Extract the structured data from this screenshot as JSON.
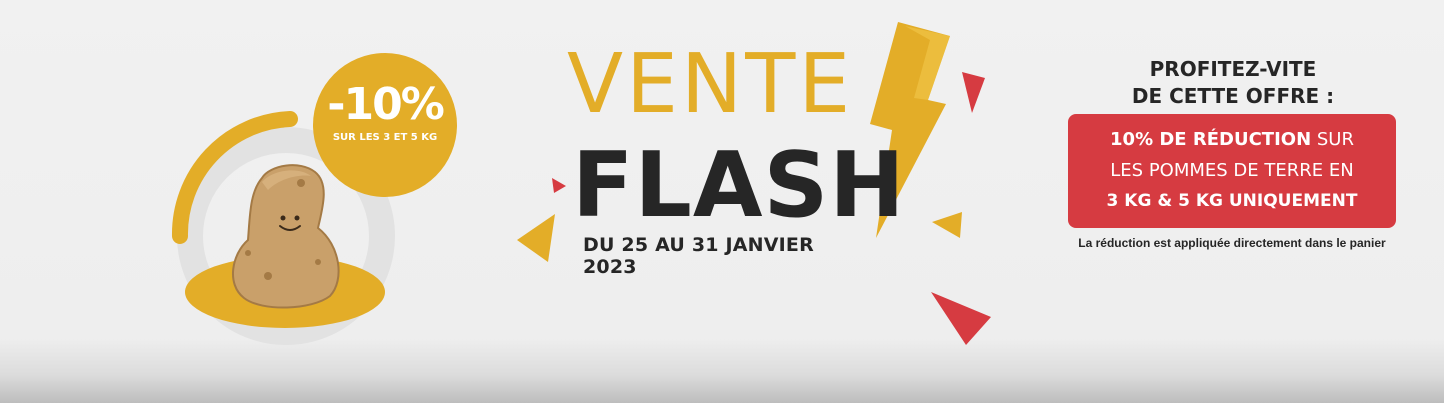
{
  "discount_badge": {
    "percent": "-10%",
    "subtitle": "SUR LES 3 ET 5 KG"
  },
  "headline": {
    "word1": "VENTE",
    "word2": "FLASH",
    "dates": "DU 25 AU 31 JANVIER 2023"
  },
  "offer": {
    "intro_line1": "PROFITEZ-VITE",
    "intro_line2": "DE CETTE OFFRE :",
    "line1_bold": "10% DE RÉDUCTION",
    "line1_rest": " SUR",
    "line2": "LES POMMES DE TERRE EN",
    "line3": "3 KG & 5 KG UNIQUEMENT",
    "note": "La réduction est appliquée directement dans le panier"
  },
  "colors": {
    "accent_yellow": "#e3ad28",
    "accent_red": "#d63b41",
    "text_dark": "#262626",
    "background": "#efefef"
  },
  "icons": [
    "potato-mascot-icon",
    "lightning-bolt-icon",
    "triangle-decoration"
  ]
}
